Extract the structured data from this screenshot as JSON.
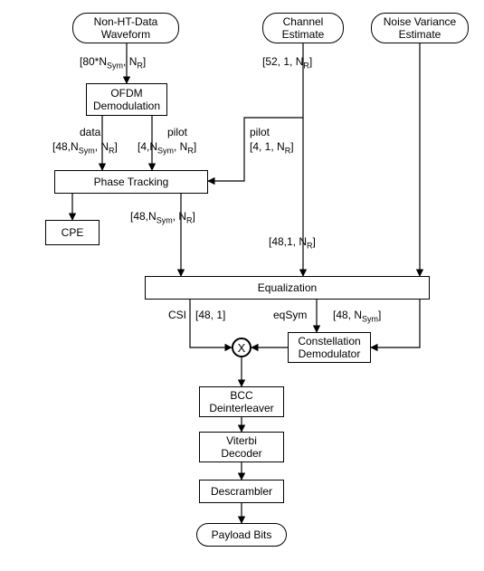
{
  "blocks": {
    "nonht": "Non-HT-Data\nWaveform",
    "chanest": "Channel\nEstimate",
    "noisevar": "Noise Variance\nEstimate",
    "ofdm": "OFDM\nDemodulation",
    "phase": "Phase Tracking",
    "cpe": "CPE",
    "equal": "Equalization",
    "constdemod": "Constellation\nDemodulator",
    "bcc": "BCC\nDeinterleaver",
    "viterbi": "Viterbi\nDecoder",
    "descr": "Descrambler",
    "payload": "Payload Bits",
    "mult": "X"
  },
  "labels": {
    "l80nsym": "[80*N",
    "l80nsym_sub": "Sym",
    "l80nsym_end": ", N",
    "l80nsym_sub2": "R",
    "l80nsym_close": "]",
    "l52": "[52, 1, N",
    "l52_sub": "R",
    "l52_close": "]",
    "data": "data",
    "pilot": "pilot",
    "d48nsym": "[48,N",
    "d48nsym_sub": "Sym",
    "d48nsym_mid": ", N",
    "d48nsym_sub2": "R",
    "d48nsym_close": "]",
    "d4nsym": "[4,N",
    "d4nsym_sub": "Sym",
    "d4nsym_mid": ", N",
    "d4nsym_sub2": "R",
    "d4nsym_close": "]",
    "d4_1": "[4, 1, N",
    "d4_1_sub": "R",
    "d4_1_close": "]",
    "d48nsym2": "[48,N",
    "d48nsym2_sub": "Sym",
    "d48nsym2_mid": ", N",
    "d48nsym2_sub2": "R",
    "d48nsym2_close": "]",
    "d48_1nr": "[48,1, N",
    "d48_1nr_sub": "R",
    "d48_1nr_close": "]",
    "csi": "CSI",
    "d48_1": "[48, 1]",
    "eqsym": "eqSym",
    "d48nsym3": "[48, N",
    "d48nsym3_sub": "Sym",
    "d48nsym3_close": "]"
  }
}
